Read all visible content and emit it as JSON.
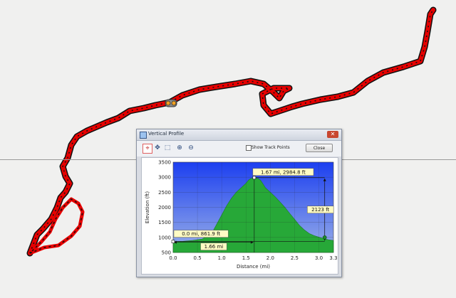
{
  "colors": {
    "map_background": "#f0f0ef",
    "track": "#e60000",
    "track_outline": "#111111",
    "sky_top": "#1c3ff0",
    "sky_bottom": "#9ab0e8",
    "terrain": "#27a838",
    "label_background": "#fffbc4"
  },
  "window": {
    "title": "Vertical Profile",
    "close_x": "✕",
    "title_icon": "profile-icon",
    "toolbar": {
      "select_icon": "select-crosshair-icon",
      "pan_icon": "pan-icon",
      "zoom_box_icon": "zoom-box-icon",
      "zoom_in_icon": "zoom-in-icon",
      "zoom_out_icon": "zoom-out-icon",
      "show_track_points_label": "Show Track Points",
      "show_track_points_checked": false,
      "close_button_label": "Close"
    }
  },
  "chart_data": {
    "type": "area",
    "xlabel": "Distance  (mi)",
    "ylabel": "Elevation (ft)",
    "xlim": [
      0,
      3.3
    ],
    "ylim": [
      500,
      3500
    ],
    "xticks": [
      0.0,
      0.5,
      1.0,
      1.5,
      2.0,
      2.5,
      3.0,
      3.3
    ],
    "xtick_labels": [
      "0.0",
      "0.5",
      "1.0",
      "1.5",
      "2.0",
      "2.5",
      "3.0",
      "3.3"
    ],
    "yticks": [
      500,
      1000,
      1500,
      2000,
      2500,
      3000,
      3500
    ],
    "ytick_labels": [
      "500",
      "1000",
      "1500",
      "2000",
      "2500",
      "3000",
      "3500"
    ],
    "grid": true,
    "series": [
      {
        "x": [
          0.0,
          0.2,
          0.4,
          0.6,
          0.8,
          0.9,
          1.0,
          1.1,
          1.2,
          1.3,
          1.4,
          1.5,
          1.55,
          1.6,
          1.67,
          1.75,
          1.8,
          1.85,
          1.9,
          2.0,
          2.1,
          2.2,
          2.3,
          2.4,
          2.5,
          2.6,
          2.7,
          2.8,
          2.9,
          3.0,
          3.1,
          3.2,
          3.3
        ],
        "y": [
          862,
          870,
          900,
          950,
          1150,
          1450,
          1750,
          2050,
          2300,
          2500,
          2650,
          2800,
          2900,
          2960,
          2985,
          2960,
          2900,
          2780,
          2650,
          2500,
          2350,
          2180,
          2000,
          1800,
          1600,
          1400,
          1250,
          1130,
          1060,
          1010,
          960,
          920,
          900
        ]
      }
    ],
    "annotations": {
      "peak_label": "1.67 mi, 2984.8 ft",
      "start_label": "0.0 mi, 861.9 ft",
      "distance_label": "1.66 mi",
      "gain_label": "2123 ft",
      "peak": {
        "x": 1.67,
        "y": 2984.8
      },
      "start": {
        "x": 0.0,
        "y": 861.9
      },
      "gain_marker_x": 3.12,
      "end_point": {
        "x": 3.12,
        "y": 1000
      }
    }
  }
}
